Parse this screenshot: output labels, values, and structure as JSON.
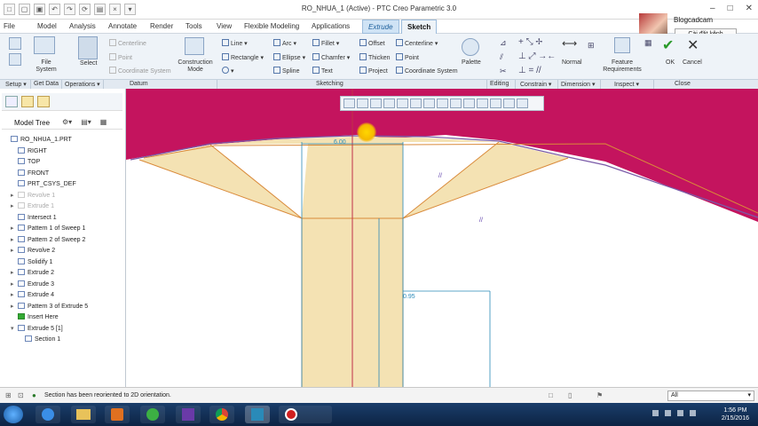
{
  "window": {
    "title": "RO_NHUA_1 (Active) - PTC Creo Parametric 3.0",
    "controls": [
      "–",
      "□",
      "✕"
    ]
  },
  "quick_access": [
    "new-icon",
    "open-icon",
    "save-icon",
    "undo-icon",
    "redo-icon",
    "regenerate-icon",
    "windows-icon",
    "close-window-icon",
    "customize-icon"
  ],
  "menu": {
    "file": "File",
    "model": "Model",
    "analysis": "Analysis",
    "annotate": "Annotate",
    "render": "Render",
    "tools": "Tools",
    "view": "View",
    "flexible": "Flexible Modeling",
    "applications": "Applications",
    "extrude": "Extrude",
    "sketch": "Sketch"
  },
  "user": {
    "name": "Blogcadcam",
    "install_button": "Cài đặt kênh"
  },
  "ribbon": {
    "file_system": "File System",
    "select": "Select",
    "centerline": "Centerline",
    "point": "Point",
    "coordinate_system": "Coordinate System",
    "construction_mode": "Construction Mode",
    "line": "Line",
    "rectangle": "Rectangle",
    "arc": "Arc",
    "ellipse": "Ellipse",
    "spline": "Spline",
    "fillet": "Fillet",
    "chamfer": "Chamfer",
    "text": "Text",
    "offset": "Offset",
    "thicken": "Thicken",
    "project": "Project",
    "centerline2": "Centerline",
    "point2": "Point",
    "coordinate_system2": "Coordinate System",
    "palette": "Palette",
    "normal": "Normal",
    "feature_requirements": "Feature Requirements",
    "ok": "OK",
    "cancel": "Cancel"
  },
  "groups": {
    "setup": "Setup ▾",
    "get_data": "Get Data",
    "operations": "Operations ▾",
    "datum": "Datum",
    "sketching": "Sketching",
    "editing": "Editing",
    "constrain": "Constrain ▾",
    "dimension": "Dimension ▾",
    "inspect": "Inspect ▾",
    "close": "Close"
  },
  "tree": {
    "title": "Model Tree",
    "items": [
      {
        "label": "RO_NHUA_1.PRT",
        "state": "normal",
        "indent": 0,
        "expand": ""
      },
      {
        "label": "RIGHT",
        "state": "normal",
        "indent": 1,
        "expand": ""
      },
      {
        "label": "TOP",
        "state": "normal",
        "indent": 1,
        "expand": ""
      },
      {
        "label": "FRONT",
        "state": "normal",
        "indent": 1,
        "expand": ""
      },
      {
        "label": "PRT_CSYS_DEF",
        "state": "normal",
        "indent": 1,
        "expand": ""
      },
      {
        "label": "Revolve 1",
        "state": "suppressed",
        "indent": 1,
        "expand": "▸"
      },
      {
        "label": "Extrude 1",
        "state": "suppressed",
        "indent": 1,
        "expand": "▸"
      },
      {
        "label": "Intersect 1",
        "state": "normal",
        "indent": 1,
        "expand": ""
      },
      {
        "label": "Pattern 1 of Sweep 1",
        "state": "normal",
        "indent": 1,
        "expand": "▸"
      },
      {
        "label": "Pattern 2 of Sweep 2",
        "state": "normal",
        "indent": 1,
        "expand": "▸"
      },
      {
        "label": "Revolve 2",
        "state": "normal",
        "indent": 1,
        "expand": "▸"
      },
      {
        "label": "Solidify 1",
        "state": "normal",
        "indent": 1,
        "expand": ""
      },
      {
        "label": "Extrude 2",
        "state": "normal",
        "indent": 1,
        "expand": "▸"
      },
      {
        "label": "Extrude 3",
        "state": "normal",
        "indent": 1,
        "expand": "▸"
      },
      {
        "label": "Extrude 4",
        "state": "normal",
        "indent": 1,
        "expand": "▸"
      },
      {
        "label": "Pattern 3 of Extrude 5",
        "state": "normal",
        "indent": 1,
        "expand": "▸"
      },
      {
        "label": "Insert Here",
        "state": "insert",
        "indent": 1,
        "expand": ""
      },
      {
        "label": "Extrude 5 [1]",
        "state": "normal",
        "indent": 1,
        "expand": "▾"
      },
      {
        "label": "Section 1",
        "state": "normal",
        "indent": 2,
        "expand": ""
      }
    ]
  },
  "sketch": {
    "dim_top": "6.00",
    "dim_bottom": "0.95"
  },
  "status": {
    "message": "Section has been reoriented to 2D orientation.",
    "filter": "All"
  },
  "taskbar": {
    "time": "1:56 PM",
    "date": "2/15/2016"
  },
  "colors": {
    "accent": "#1b5e9b",
    "part_surface": "#c4145e",
    "section_fill": "#f4e2b3",
    "section_edge": "#d98a3a",
    "dimension": "#2a8ab8"
  }
}
